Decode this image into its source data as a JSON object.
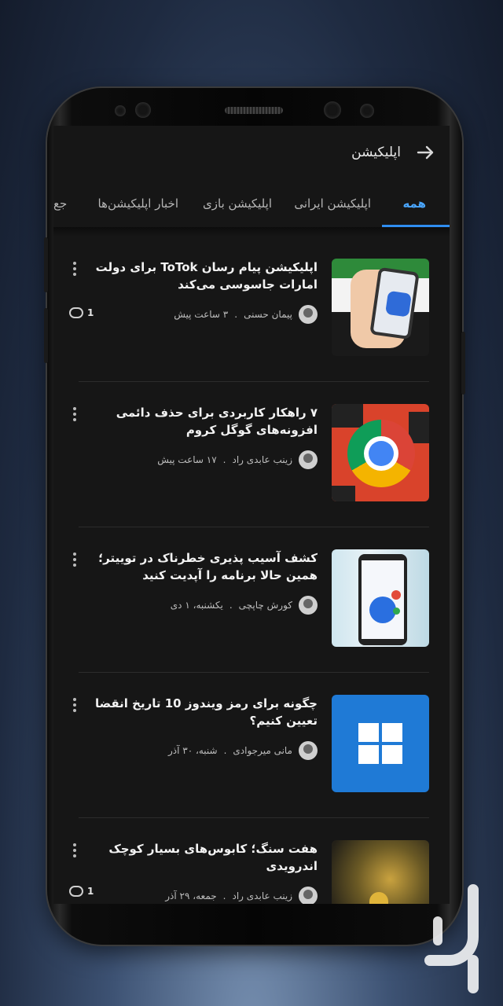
{
  "header": {
    "title": "اپلیکیشن",
    "back_icon": "arrow-right-icon"
  },
  "tabs": [
    {
      "label": "همه",
      "active": true
    },
    {
      "label": "اپلیکیشن ایرانی",
      "active": false
    },
    {
      "label": "اپلیکیشن بازی",
      "active": false
    },
    {
      "label": "اخبار اپلیکیشن‌ها",
      "active": false
    },
    {
      "label": "جع",
      "active": false
    }
  ],
  "articles": [
    {
      "title": "اپلیکیشن پیام رسان ToTok برای دولت امارات جاسوسی می‌کند",
      "author": "پیمان حسنی",
      "time": "۳ ساعت پیش",
      "comments": "1"
    },
    {
      "title": "۷ راهکار کاربردی برای حذف دائمی افزونه‌های گوگل کروم",
      "author": "زینب عابدی راد",
      "time": "۱۷ ساعت پیش",
      "comments": ""
    },
    {
      "title": "کشف آسیب پذیری خطرناک در توییتر؛ همین حالا برنامه را آپدیت کنید",
      "author": "کورش چاپچی",
      "time": "یکشنبه، ۱ دی",
      "comments": ""
    },
    {
      "title": "چگونه برای رمز ویندوز 10 تاریخ انقضا تعیین کنیم؟",
      "author": "مانی میرجوادی",
      "time": "شنبه، ۳۰ آذر",
      "comments": ""
    },
    {
      "title": "هفت سنگ؛ کابوس‌های بسیار کوچک اندرویدی",
      "author": "زینب عابدی راد",
      "time": "جمعه، ۲۹ آذر",
      "comments": "1"
    }
  ],
  "colors": {
    "accent": "#2f8df0",
    "background": "#161616"
  }
}
